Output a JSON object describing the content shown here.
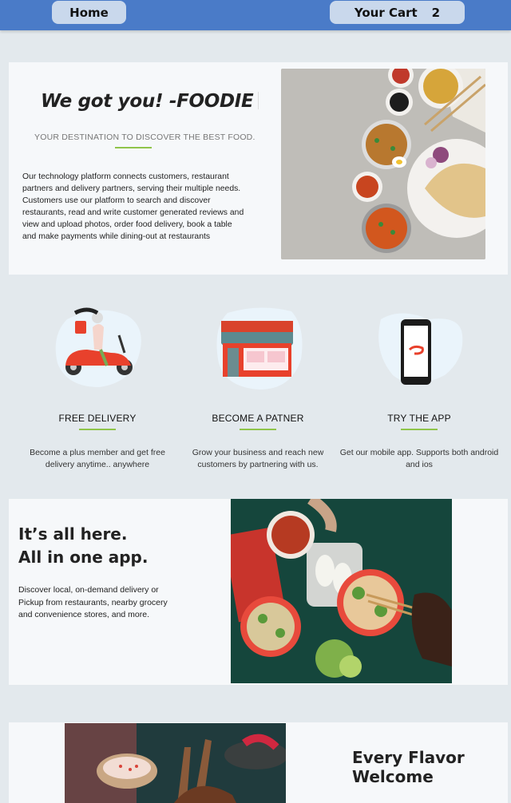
{
  "nav": {
    "home_label": "Home",
    "cart_label": "Your Cart",
    "cart_count": "2"
  },
  "hero": {
    "title": "We got you! -FOODIE",
    "subtitle": "YOUR DESTINATION TO DISCOVER THE BEST FOOD.",
    "description": "Our technology platform connects customers, restaurant partners and delivery partners, serving their multiple needs. Customers use our platform to search and discover restaurants, read and write customer generated reviews and view and upload photos, order food delivery, book a table and make payments while dining-out at restaurants",
    "image_icon": "food-spread-photo"
  },
  "features": [
    {
      "icon": "scooter-delivery-icon",
      "title": "FREE DELIVERY",
      "text": "Become a plus member and get free delivery anytime.. anywhere"
    },
    {
      "icon": "storefront-icon",
      "title": "BECOME A PATNER",
      "text": "Grow your business and reach new customers by partnering with us."
    },
    {
      "icon": "mobile-app-icon",
      "title": "TRY THE APP",
      "text": "Get our mobile app. Supports both android and ios"
    }
  ],
  "app_section": {
    "title_line1": "It’s all here.",
    "title_line2": "All in one app.",
    "text": "Discover local, on-demand delivery or Pickup from restaurants, nearby grocery and convenience stores, and more.",
    "image_icon": "noodle-bowls-photo"
  },
  "flavor": {
    "title_line1": "Every Flavor",
    "title_line2": "Welcome",
    "image_icon": "lamb-chops-photo"
  },
  "colors": {
    "navbar": "#4a7bc8",
    "nav_button": "#c9d8ec",
    "accent_line": "#8fc44a",
    "page_bg": "#e3e9ed",
    "card_bg": "#f6f8fa",
    "brand_red": "#e8412c"
  }
}
